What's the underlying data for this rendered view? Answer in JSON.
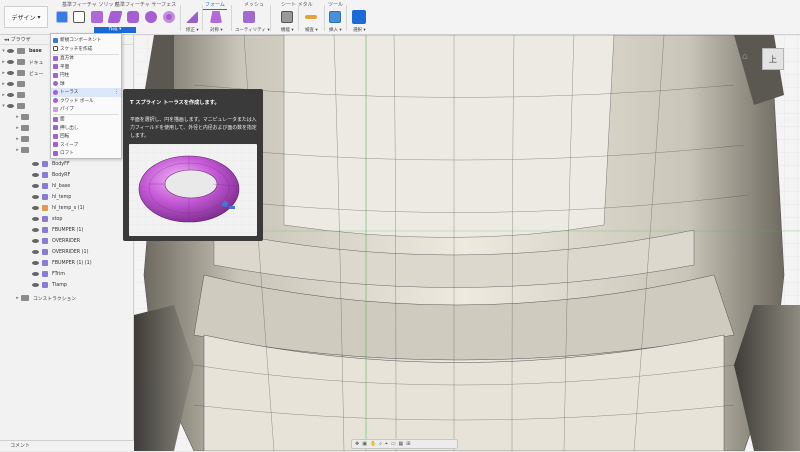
{
  "workspace": {
    "label": "デザイン"
  },
  "tabs": {
    "solid": "基準フィーチャ ソリッド",
    "surface": "基準フィーチャ サーフェス",
    "form": "フォーム",
    "mesh": "メッシュ",
    "sheetmetal": "シート メタル",
    "tools": "ツール"
  },
  "groups": {
    "create": "作成 ▾",
    "modify": "修正 ▾",
    "symmetry": "対称 ▾",
    "utility": "ユーティリティ ▾",
    "assemble": "機能 ▾",
    "inspect": "検査 ▾",
    "insert": "挿入 ▾",
    "select": "選択 ▾"
  },
  "browser": {
    "title": "ブラウザ",
    "rows": [
      {
        "label": "base"
      },
      {
        "label": "ドキュ"
      },
      {
        "label": "ビュー"
      },
      {
        "label": ""
      },
      {
        "label": ""
      },
      {
        "label": ""
      },
      {
        "label": ""
      },
      {
        "label": ""
      },
      {
        "label": ""
      },
      {
        "label": ""
      },
      {
        "label": "BodyFF"
      },
      {
        "label": "BodyRF"
      },
      {
        "label": "hl_base"
      },
      {
        "label": "hl_temp"
      },
      {
        "label": "hl_temp_s (1)"
      },
      {
        "label": "stop"
      },
      {
        "label": "FBUMPER (1)"
      },
      {
        "label": "OVERRIDER"
      },
      {
        "label": "OVERRIDER (1)"
      },
      {
        "label": "FBUMPER (1) (1)"
      },
      {
        "label": "FTrim"
      },
      {
        "label": "Tlamp"
      },
      {
        "label": "コンストラクション"
      }
    ]
  },
  "comments": {
    "label": "コメント"
  },
  "viewcube": {
    "face": "上"
  },
  "menu": {
    "items": [
      {
        "label": "新規コンポーネント"
      },
      {
        "label": "スケッチを作成"
      },
      {
        "label": "直方体"
      },
      {
        "label": "平面"
      },
      {
        "label": "円柱"
      },
      {
        "label": "球"
      },
      {
        "label": "トーラス"
      },
      {
        "label": "クワッド ボール"
      },
      {
        "label": "パイプ"
      },
      {
        "label": "面"
      },
      {
        "label": "押し出し"
      },
      {
        "label": "回転"
      },
      {
        "label": "スイープ"
      },
      {
        "label": "ロフト"
      }
    ]
  },
  "tooltip": {
    "title": "T スプライン トーラスを作成します。",
    "body": "平面を選択し、円を描画します。マニピュレータまたは入力フィールドを使用して、外径と内径および面の数を指定します。"
  },
  "colors": {
    "accent": "#1b6ad8",
    "tspline": "#b84fc4"
  }
}
